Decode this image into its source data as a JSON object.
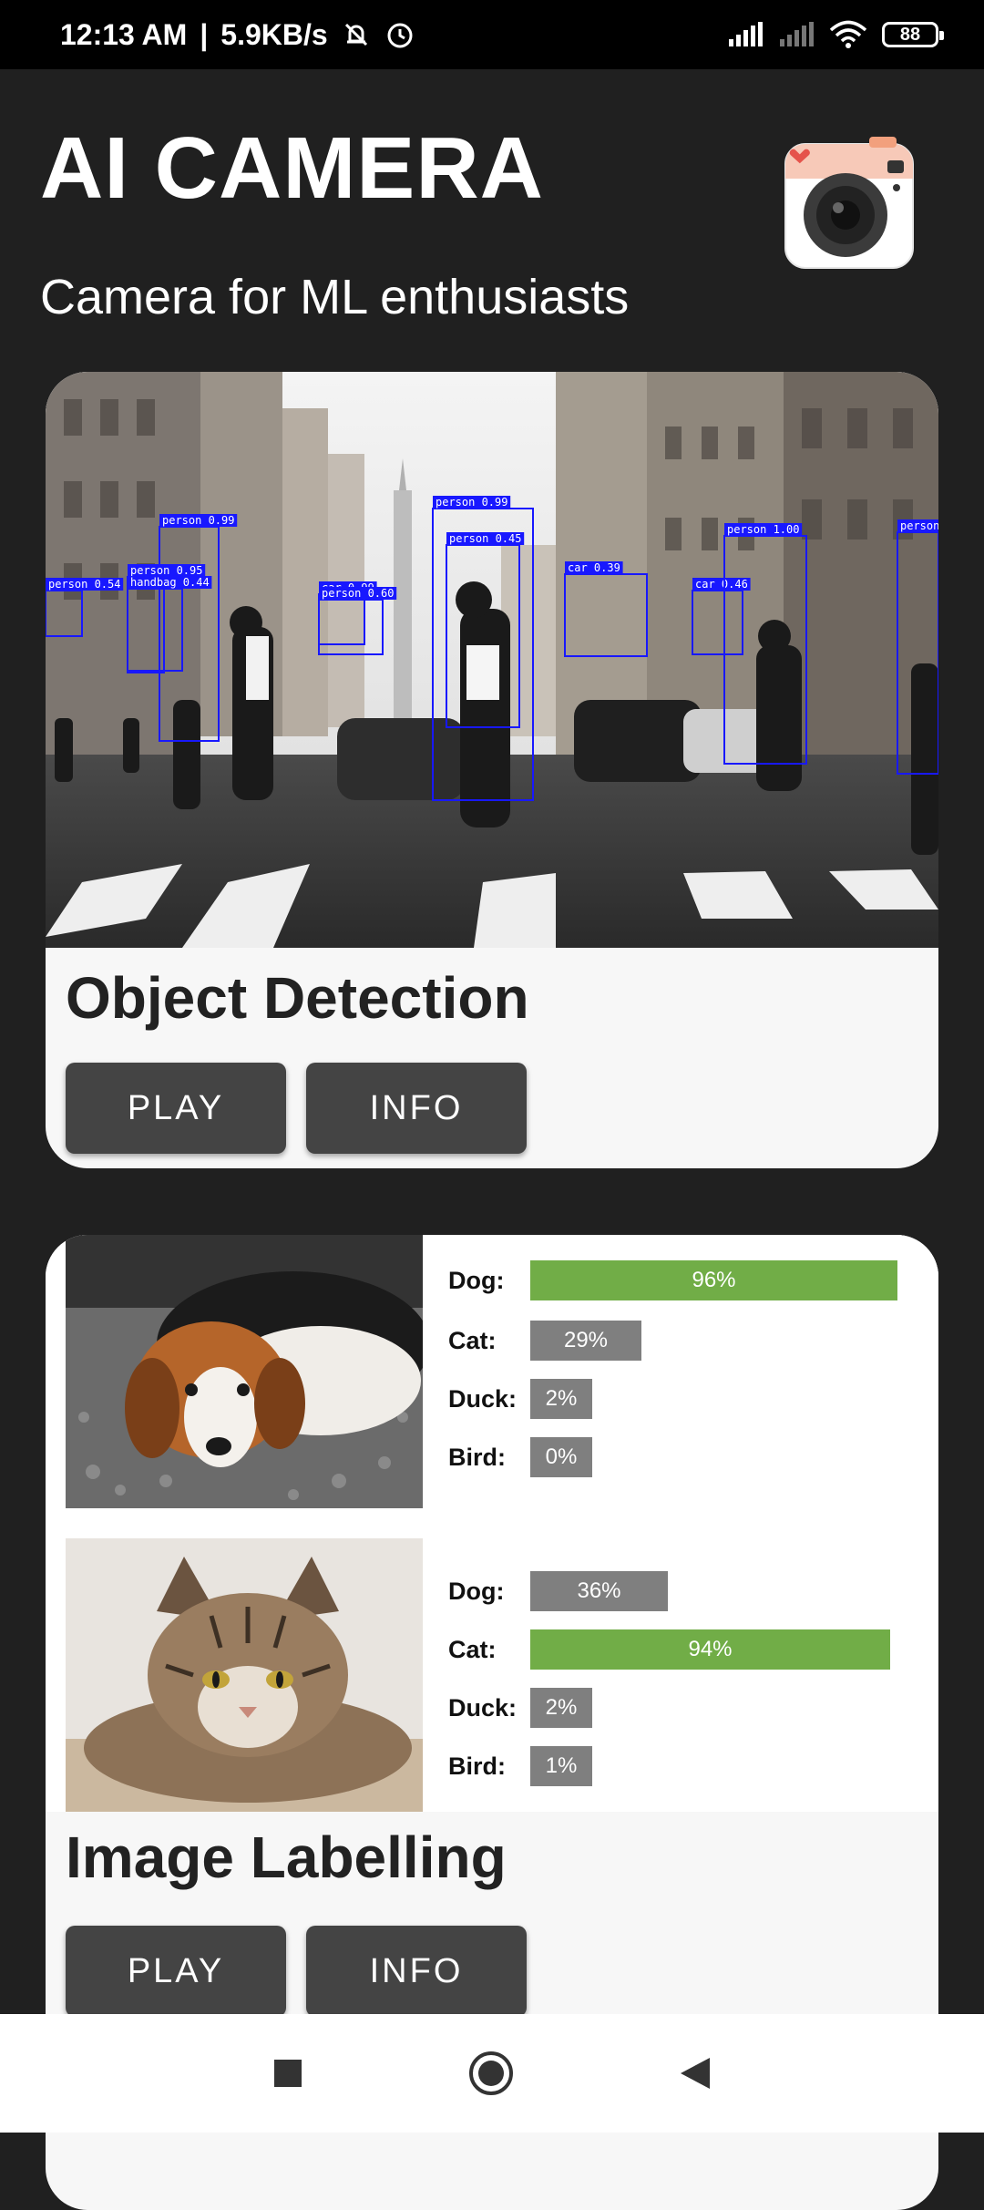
{
  "status_bar": {
    "time": "12:13 AM",
    "separator": "|",
    "speed": "5.9KB/s",
    "battery": "88"
  },
  "header": {
    "title": "AI CAMERA",
    "subtitle": "Camera for ML enthusiasts"
  },
  "object_detection": {
    "title": "Object Detection",
    "play_label": "PLAY",
    "info_label": "INFO",
    "box_color": "#1818ff",
    "boxes": [
      {
        "label": "person 0.99"
      },
      {
        "label": "person 0.95"
      },
      {
        "label": "person 0.54"
      },
      {
        "label": "handbag 0.44"
      },
      {
        "label": "car 0.99"
      },
      {
        "label": "person 0.60"
      },
      {
        "label": "person 0.99"
      },
      {
        "label": "person 0.45"
      },
      {
        "label": "car 0.39"
      },
      {
        "label": "car 0.46"
      },
      {
        "label": "person 1.00"
      },
      {
        "label": "person"
      }
    ]
  },
  "image_labelling": {
    "title": "Image Labelling",
    "play_label": "PLAY",
    "info_label": "INFO",
    "top_color": "#71ad47",
    "other_color": "#7f7f7f",
    "rows": [
      {
        "image": "beagle-puppy",
        "labels": [
          {
            "label": "Dog:",
            "value": "96%",
            "fraction": 0.96,
            "top": true
          },
          {
            "label": "Cat:",
            "value": "29%",
            "fraction": 0.29,
            "top": false
          },
          {
            "label": "Duck:",
            "value": "2%",
            "fraction": 0.02,
            "top": false
          },
          {
            "label": "Bird:",
            "value": "0%",
            "fraction": 0.0,
            "top": false
          }
        ]
      },
      {
        "image": "tabby-cat",
        "labels": [
          {
            "label": "Dog:",
            "value": "36%",
            "fraction": 0.36,
            "top": false
          },
          {
            "label": "Cat:",
            "value": "94%",
            "fraction": 0.94,
            "top": true
          },
          {
            "label": "Duck:",
            "value": "2%",
            "fraction": 0.02,
            "top": false
          },
          {
            "label": "Bird:",
            "value": "1%",
            "fraction": 0.01,
            "top": false
          }
        ]
      }
    ]
  },
  "nav": {
    "icons": [
      "recents-square-icon",
      "home-circle-icon",
      "back-triangle-icon"
    ]
  }
}
